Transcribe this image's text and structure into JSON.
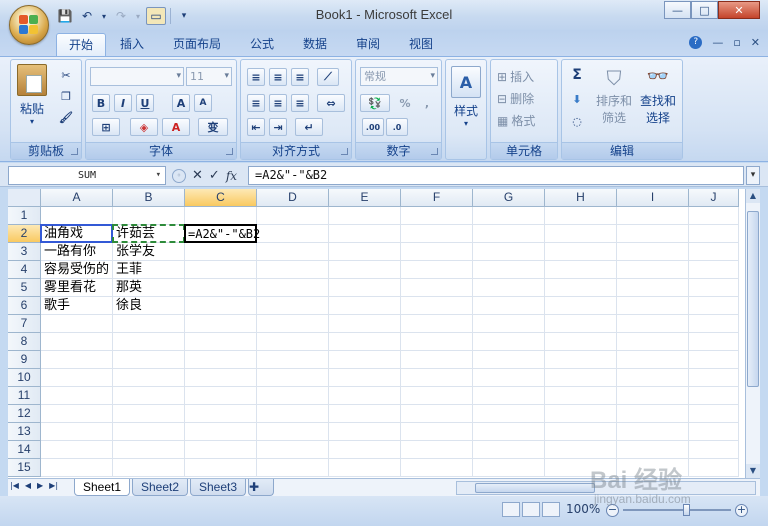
{
  "app": {
    "title": "Book1 - Microsoft Excel"
  },
  "tabs": [
    "开始",
    "插入",
    "页面布局",
    "公式",
    "数据",
    "审阅",
    "视图"
  ],
  "ribbon": {
    "clipboard": {
      "label": "剪贴板",
      "paste": "粘贴"
    },
    "font": {
      "label": "字体",
      "size": "11"
    },
    "alignment": {
      "label": "对齐方式"
    },
    "number": {
      "label": "数字",
      "format": "常规",
      "percent": "%",
      "comma": ","
    },
    "styles": {
      "button": "样式"
    },
    "cells": {
      "label": "单元格",
      "insert": "插入",
      "delete": "删除",
      "format": "格式"
    },
    "editing": {
      "label": "编辑",
      "sum": "Σ",
      "sort_line1": "排序和",
      "sort_line2": "筛选",
      "find_line1": "查找和",
      "find_line2": "选择"
    }
  },
  "formula_bar": {
    "name_box": "SUM",
    "formula": "=A2&\"-\"&B2",
    "fx": "fx"
  },
  "columns": [
    "A",
    "B",
    "C",
    "D",
    "E",
    "F",
    "G",
    "H",
    "I",
    "J"
  ],
  "rows": [
    "1",
    "2",
    "3",
    "4",
    "5",
    "6",
    "7",
    "8",
    "9",
    "10",
    "11",
    "12",
    "13",
    "14",
    "15"
  ],
  "cells": {
    "A2": "油角戏",
    "B2": "许茹芸",
    "C2": "=A2&\"-\"&B2",
    "A3": "一路有你",
    "B3": "张学友",
    "A4": "容易受伤的",
    "B4": "王菲",
    "A5": "雾里看花",
    "B5": "那英",
    "A6": "歌手",
    "B6": "徐良"
  },
  "sheets": [
    "Sheet1",
    "Sheet2",
    "Sheet3"
  ],
  "status": {
    "zoom": "100%"
  },
  "watermark": {
    "line1": "Bai 经验",
    "line2": "jingyan.baidu.com"
  }
}
